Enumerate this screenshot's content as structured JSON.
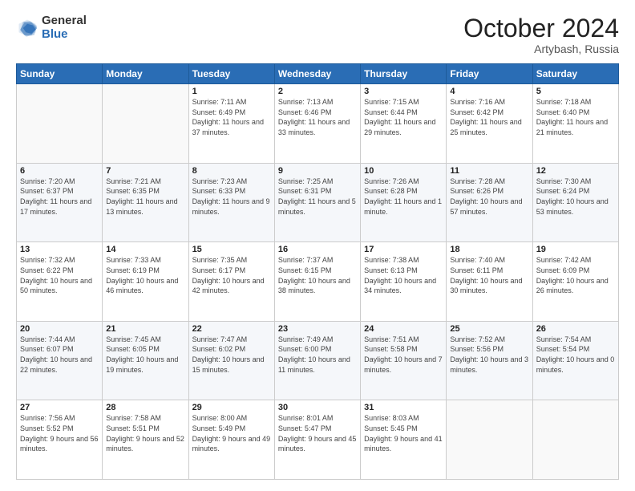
{
  "header": {
    "logo_general": "General",
    "logo_blue": "Blue",
    "month_title": "October 2024",
    "location": "Artybash, Russia"
  },
  "days_of_week": [
    "Sunday",
    "Monday",
    "Tuesday",
    "Wednesday",
    "Thursday",
    "Friday",
    "Saturday"
  ],
  "weeks": [
    [
      {
        "day": "",
        "info": ""
      },
      {
        "day": "",
        "info": ""
      },
      {
        "day": "1",
        "info": "Sunrise: 7:11 AM\nSunset: 6:49 PM\nDaylight: 11 hours and 37 minutes."
      },
      {
        "day": "2",
        "info": "Sunrise: 7:13 AM\nSunset: 6:46 PM\nDaylight: 11 hours and 33 minutes."
      },
      {
        "day": "3",
        "info": "Sunrise: 7:15 AM\nSunset: 6:44 PM\nDaylight: 11 hours and 29 minutes."
      },
      {
        "day": "4",
        "info": "Sunrise: 7:16 AM\nSunset: 6:42 PM\nDaylight: 11 hours and 25 minutes."
      },
      {
        "day": "5",
        "info": "Sunrise: 7:18 AM\nSunset: 6:40 PM\nDaylight: 11 hours and 21 minutes."
      }
    ],
    [
      {
        "day": "6",
        "info": "Sunrise: 7:20 AM\nSunset: 6:37 PM\nDaylight: 11 hours and 17 minutes."
      },
      {
        "day": "7",
        "info": "Sunrise: 7:21 AM\nSunset: 6:35 PM\nDaylight: 11 hours and 13 minutes."
      },
      {
        "day": "8",
        "info": "Sunrise: 7:23 AM\nSunset: 6:33 PM\nDaylight: 11 hours and 9 minutes."
      },
      {
        "day": "9",
        "info": "Sunrise: 7:25 AM\nSunset: 6:31 PM\nDaylight: 11 hours and 5 minutes."
      },
      {
        "day": "10",
        "info": "Sunrise: 7:26 AM\nSunset: 6:28 PM\nDaylight: 11 hours and 1 minute."
      },
      {
        "day": "11",
        "info": "Sunrise: 7:28 AM\nSunset: 6:26 PM\nDaylight: 10 hours and 57 minutes."
      },
      {
        "day": "12",
        "info": "Sunrise: 7:30 AM\nSunset: 6:24 PM\nDaylight: 10 hours and 53 minutes."
      }
    ],
    [
      {
        "day": "13",
        "info": "Sunrise: 7:32 AM\nSunset: 6:22 PM\nDaylight: 10 hours and 50 minutes."
      },
      {
        "day": "14",
        "info": "Sunrise: 7:33 AM\nSunset: 6:19 PM\nDaylight: 10 hours and 46 minutes."
      },
      {
        "day": "15",
        "info": "Sunrise: 7:35 AM\nSunset: 6:17 PM\nDaylight: 10 hours and 42 minutes."
      },
      {
        "day": "16",
        "info": "Sunrise: 7:37 AM\nSunset: 6:15 PM\nDaylight: 10 hours and 38 minutes."
      },
      {
        "day": "17",
        "info": "Sunrise: 7:38 AM\nSunset: 6:13 PM\nDaylight: 10 hours and 34 minutes."
      },
      {
        "day": "18",
        "info": "Sunrise: 7:40 AM\nSunset: 6:11 PM\nDaylight: 10 hours and 30 minutes."
      },
      {
        "day": "19",
        "info": "Sunrise: 7:42 AM\nSunset: 6:09 PM\nDaylight: 10 hours and 26 minutes."
      }
    ],
    [
      {
        "day": "20",
        "info": "Sunrise: 7:44 AM\nSunset: 6:07 PM\nDaylight: 10 hours and 22 minutes."
      },
      {
        "day": "21",
        "info": "Sunrise: 7:45 AM\nSunset: 6:05 PM\nDaylight: 10 hours and 19 minutes."
      },
      {
        "day": "22",
        "info": "Sunrise: 7:47 AM\nSunset: 6:02 PM\nDaylight: 10 hours and 15 minutes."
      },
      {
        "day": "23",
        "info": "Sunrise: 7:49 AM\nSunset: 6:00 PM\nDaylight: 10 hours and 11 minutes."
      },
      {
        "day": "24",
        "info": "Sunrise: 7:51 AM\nSunset: 5:58 PM\nDaylight: 10 hours and 7 minutes."
      },
      {
        "day": "25",
        "info": "Sunrise: 7:52 AM\nSunset: 5:56 PM\nDaylight: 10 hours and 3 minutes."
      },
      {
        "day": "26",
        "info": "Sunrise: 7:54 AM\nSunset: 5:54 PM\nDaylight: 10 hours and 0 minutes."
      }
    ],
    [
      {
        "day": "27",
        "info": "Sunrise: 7:56 AM\nSunset: 5:52 PM\nDaylight: 9 hours and 56 minutes."
      },
      {
        "day": "28",
        "info": "Sunrise: 7:58 AM\nSunset: 5:51 PM\nDaylight: 9 hours and 52 minutes."
      },
      {
        "day": "29",
        "info": "Sunrise: 8:00 AM\nSunset: 5:49 PM\nDaylight: 9 hours and 49 minutes."
      },
      {
        "day": "30",
        "info": "Sunrise: 8:01 AM\nSunset: 5:47 PM\nDaylight: 9 hours and 45 minutes."
      },
      {
        "day": "31",
        "info": "Sunrise: 8:03 AM\nSunset: 5:45 PM\nDaylight: 9 hours and 41 minutes."
      },
      {
        "day": "",
        "info": ""
      },
      {
        "day": "",
        "info": ""
      }
    ]
  ]
}
